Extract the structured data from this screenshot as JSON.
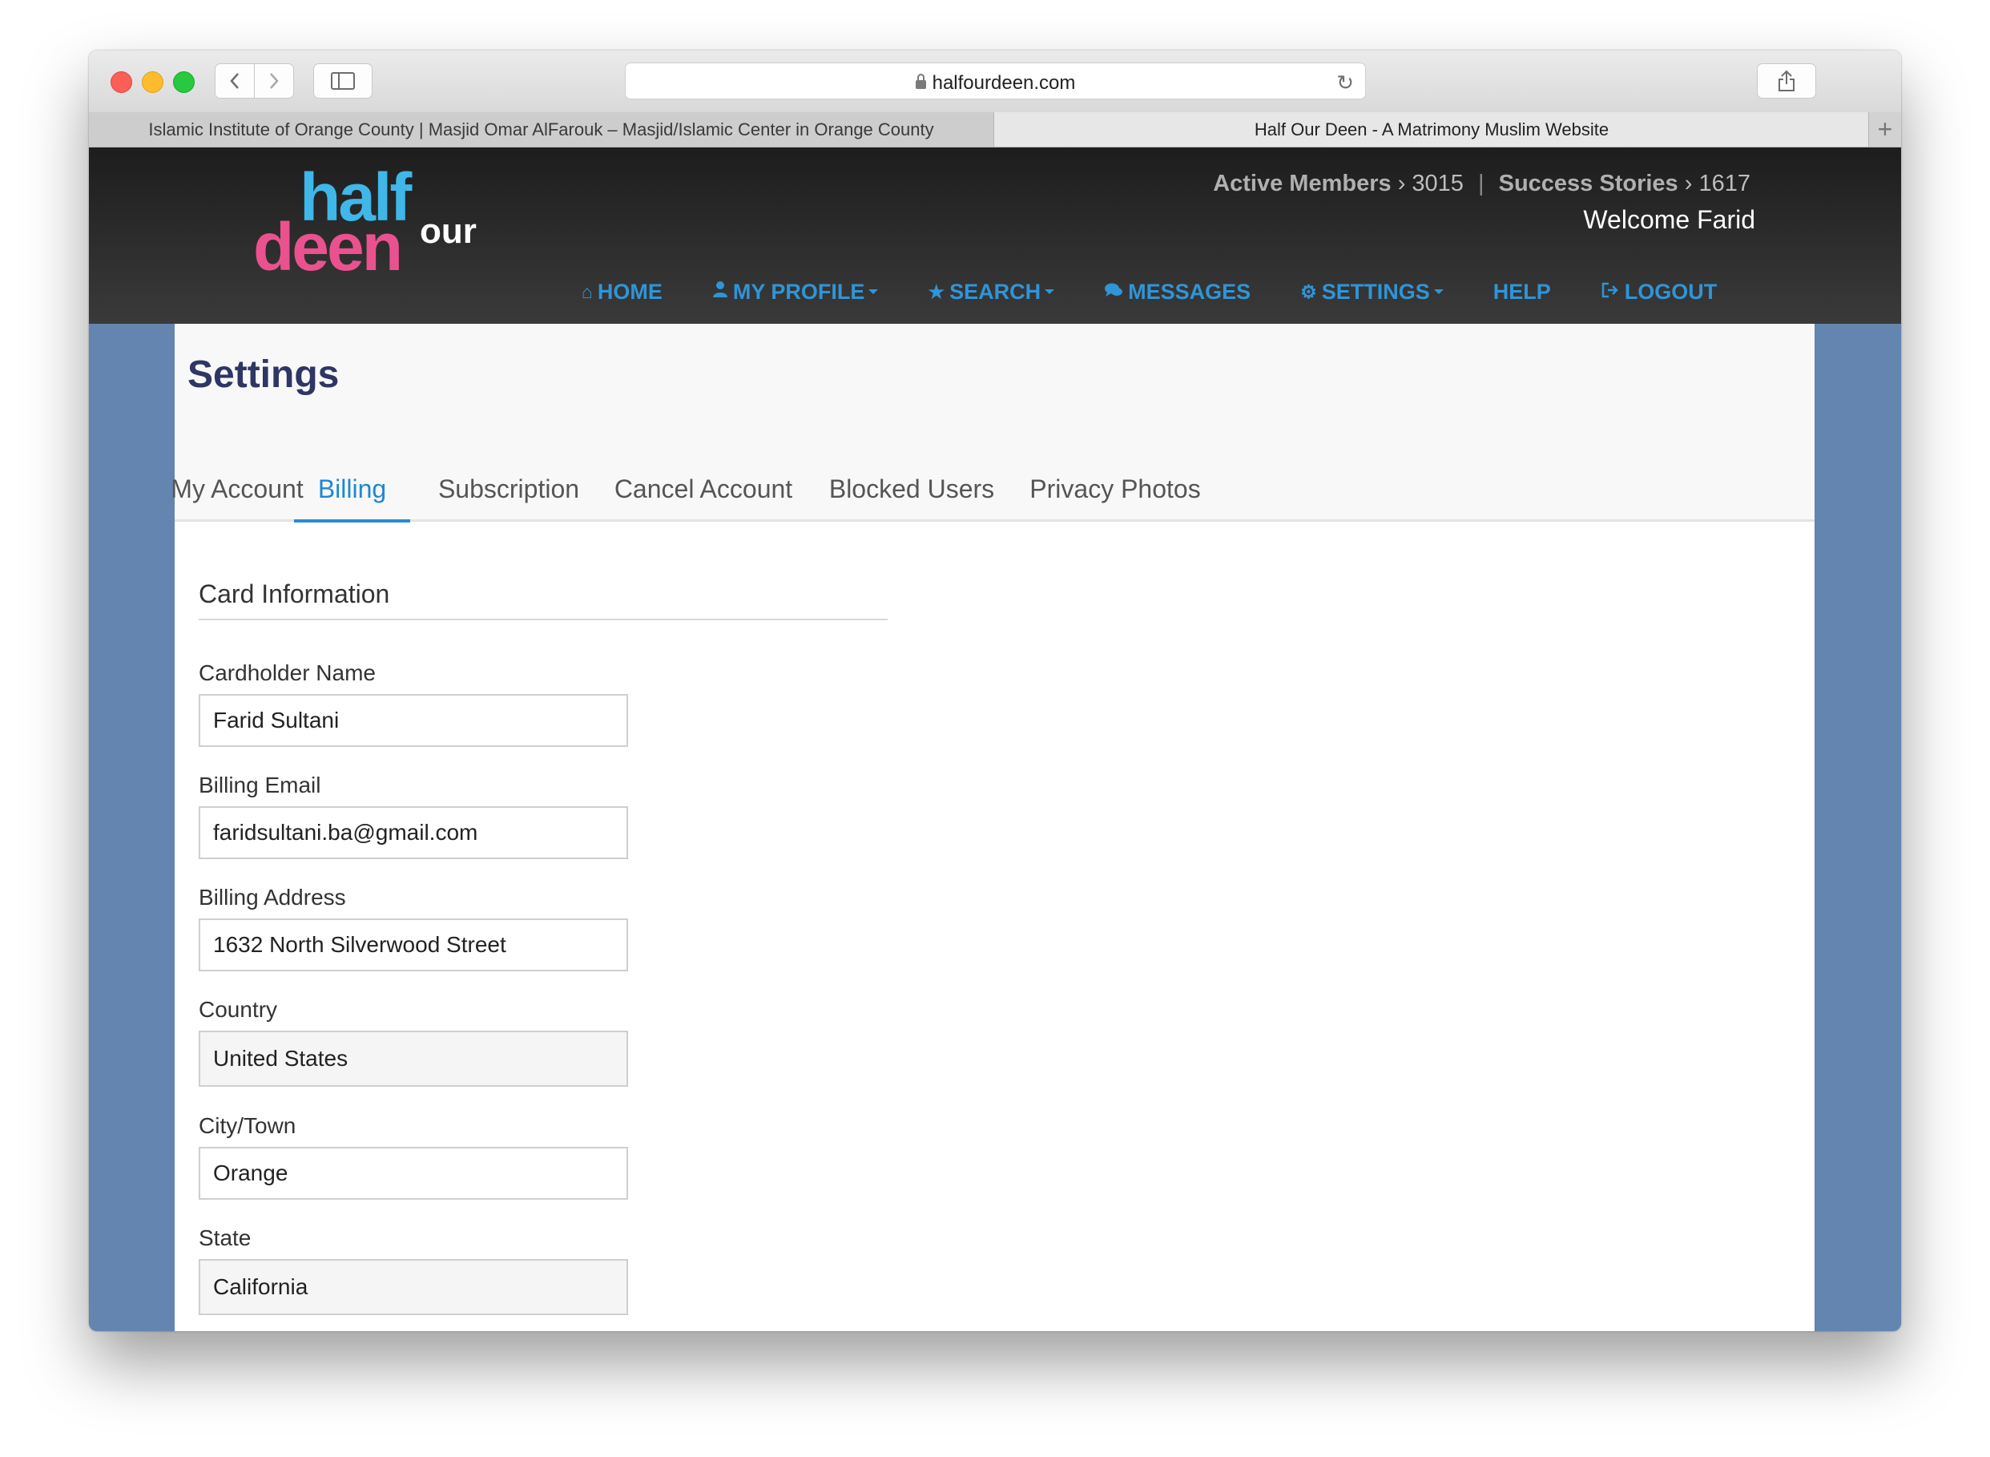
{
  "browser": {
    "url": "halfourdeen.com",
    "tabs": [
      {
        "label": "Islamic Institute of Orange County | Masjid Omar AlFarouk – Masjid/Islamic Center in Orange County"
      },
      {
        "label": "Half Our Deen - A Matrimony Muslim Website"
      }
    ]
  },
  "site": {
    "logo": {
      "half": "half",
      "deen": "deen",
      "our": "our"
    },
    "stats": {
      "active_label": "Active Members",
      "active_value": "3015",
      "success_label": "Success Stories",
      "success_value": "1617",
      "arrow": "›",
      "separator": "|"
    },
    "welcome": "Welcome Farid",
    "nav": [
      {
        "label": "HOME",
        "icon": "home-icon",
        "glyph": "⌂",
        "dropdown": false
      },
      {
        "label": "MY PROFILE",
        "icon": "user-icon",
        "glyph": "👤",
        "dropdown": true
      },
      {
        "label": "SEARCH",
        "icon": "star-icon",
        "glyph": "★",
        "dropdown": true
      },
      {
        "label": "MESSAGES",
        "icon": "chat-icon",
        "glyph": "💬",
        "dropdown": false
      },
      {
        "label": "SETTINGS",
        "icon": "gear-icon",
        "glyph": "⚙",
        "dropdown": true
      },
      {
        "label": "HELP",
        "icon": "",
        "glyph": "",
        "dropdown": false
      },
      {
        "label": "LOGOUT",
        "icon": "logout-icon",
        "glyph": "⇥",
        "dropdown": false
      }
    ]
  },
  "settings": {
    "title": "Settings",
    "tabs": [
      "My Account",
      "Billing",
      "Subscription",
      "Cancel Account",
      "Blocked Users",
      "Privacy Photos"
    ],
    "active_tab": "Billing",
    "section_title": "Card Information",
    "fields": {
      "cardholder_name": {
        "label": "Cardholder Name",
        "value": "Farid Sultani"
      },
      "billing_email": {
        "label": "Billing Email",
        "value": "faridsultani.ba@gmail.com"
      },
      "billing_address": {
        "label": "Billing Address",
        "value": "1632 North Silverwood Street"
      },
      "country": {
        "label": "Country",
        "value": "United States"
      },
      "city": {
        "label": "City/Town",
        "value": "Orange"
      },
      "state": {
        "label": "State",
        "value": "California"
      }
    }
  },
  "colors": {
    "brand_blue": "#3fb7e8",
    "brand_pink": "#e9528f",
    "nav_blue": "#2f95d7",
    "title_navy": "#2f3665",
    "page_bg": "#6385b0"
  }
}
